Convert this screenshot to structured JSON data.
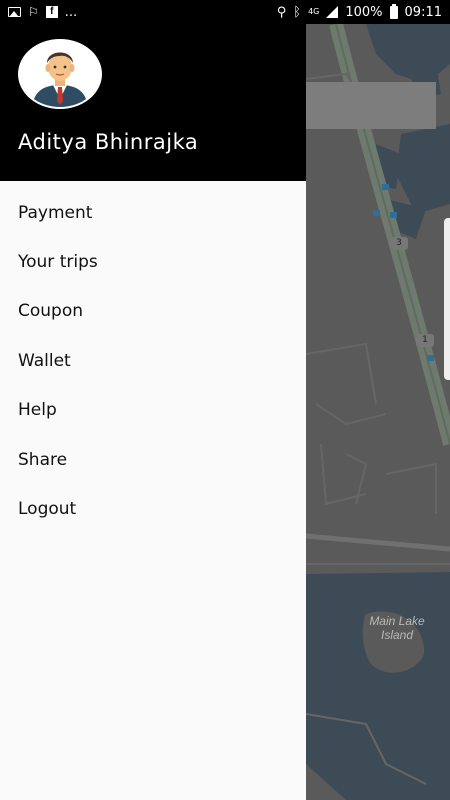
{
  "status_bar": {
    "battery": "100%",
    "time": "09:11",
    "network": "4G",
    "more": "...",
    "icons": [
      "image-icon",
      "notification-icon",
      "facebook-icon",
      "location-icon",
      "bluetooth-icon",
      "signal-icon",
      "battery-icon"
    ]
  },
  "drawer": {
    "user_name": "Aditya Bhinrajka",
    "menu": [
      {
        "label": "Payment"
      },
      {
        "label": "Your trips"
      },
      {
        "label": "Coupon"
      },
      {
        "label": "Wallet"
      },
      {
        "label": "Help"
      },
      {
        "label": "Share"
      },
      {
        "label": "Logout"
      }
    ]
  },
  "map": {
    "place_label_line1": "Main Lake",
    "place_label_line2": "Island",
    "route_badges": [
      "3",
      "1"
    ]
  },
  "colors": {
    "header_bg": "#000000",
    "drawer_bg": "#fafafa",
    "map_overlay": "#5a5a5a"
  }
}
